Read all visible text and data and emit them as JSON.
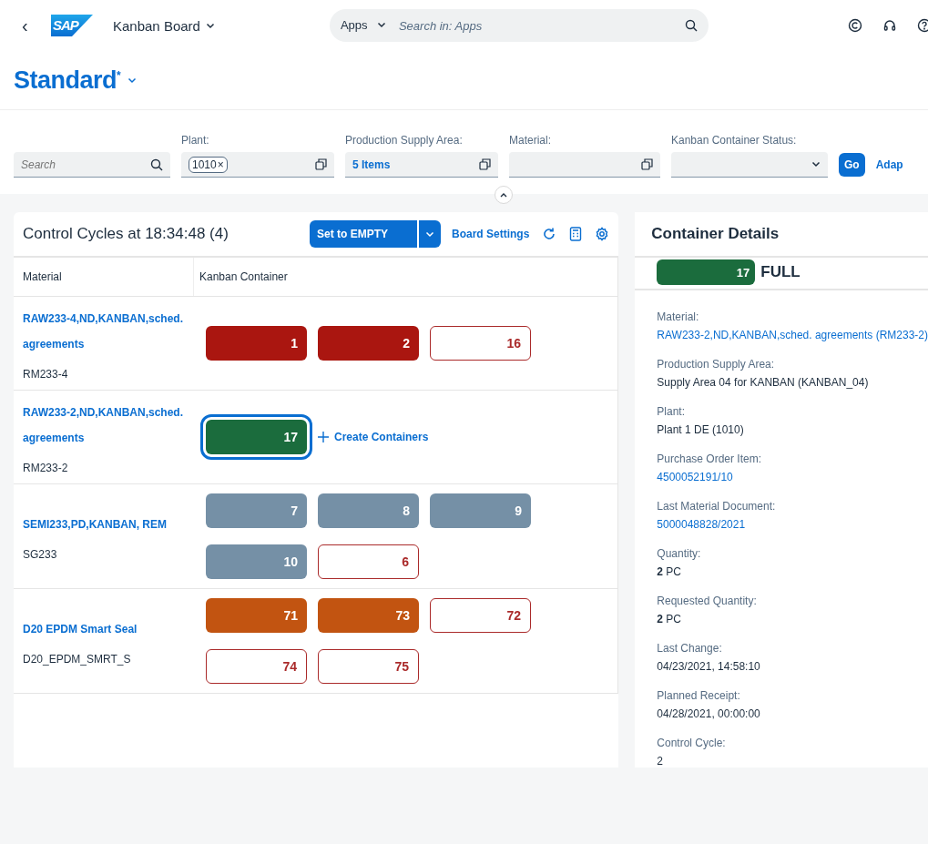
{
  "shell": {
    "back": "‹",
    "logo": "SAP",
    "app_title": "Kanban Board",
    "search_scope": "Apps",
    "search_placeholder": "Search in: Apps"
  },
  "variant": {
    "title": "Standard$^{*}$"
  },
  "filters": {
    "search_placeholder": "Search",
    "fields": [
      {
        "label": "Plant:",
        "kind": "token",
        "value": "1010",
        "remove": "×"
      },
      {
        "label": "Production Supply Area:",
        "kind": "link",
        "value": "5 Items"
      },
      {
        "label": "Material:",
        "kind": "valuehelp"
      },
      {
        "label": "Kanban Container Status:",
        "kind": "select"
      }
    ],
    "go": "Go",
    "adapt": "Adap"
  },
  "board": {
    "title": "Control Cycles at 18:34:48 (4)",
    "action": "Set to EMPTY",
    "settings": "Board Settings",
    "columns": [
      "Material",
      "Kanban Container"
    ],
    "rows": [
      {
        "material": "RAW233-4,ND,KANBAN,sched. agreements",
        "id": "RM233-4",
        "containers": [
          {
            "number": "1",
            "kind": "filled",
            "color": "#aa1610",
            "selected": false
          },
          {
            "number": "2",
            "kind": "filled",
            "color": "#aa1610",
            "selected": false
          },
          {
            "number": "16",
            "kind": "outline",
            "color": "#aa2a2a",
            "selected": false
          }
        ]
      },
      {
        "material": "RAW233-2,ND,KANBAN,sched. agreements",
        "id": "RM233-2",
        "containers": [
          {
            "number": "17",
            "kind": "filled",
            "color": "#1b6c3d",
            "selected": true
          }
        ],
        "create": "Create Containers"
      },
      {
        "material": "SEMI233,PD,KANBAN, REM",
        "id": "SG233",
        "containers": [
          {
            "number": "7",
            "kind": "filled",
            "color": "#7590a6",
            "selected": false
          },
          {
            "number": "8",
            "kind": "filled",
            "color": "#7590a6",
            "selected": false
          },
          {
            "number": "9",
            "kind": "filled",
            "color": "#7590a6",
            "selected": false
          },
          {
            "number": "10",
            "kind": "filled",
            "color": "#7590a6",
            "selected": false
          },
          {
            "number": "6",
            "kind": "outline",
            "color": "#aa2a2a",
            "selected": false
          }
        ]
      },
      {
        "material": "D20 EPDM Smart Seal",
        "id": "D20_EPDM_SMRT_S",
        "containers": [
          {
            "number": "71",
            "kind": "filled",
            "color": "#c25411",
            "selected": false
          },
          {
            "number": "73",
            "kind": "filled",
            "color": "#c25411",
            "selected": false
          },
          {
            "number": "72",
            "kind": "outline",
            "color": "#aa2a2a",
            "selected": false
          },
          {
            "number": "74",
            "kind": "outline",
            "color": "#aa2a2a",
            "selected": false
          },
          {
            "number": "75",
            "kind": "outline",
            "color": "#aa2a2a",
            "selected": false
          }
        ]
      }
    ]
  },
  "details": {
    "title": "Container Details",
    "container": {
      "number": "17",
      "kind": "filled",
      "color": "#1b6c3d",
      "status_text": "FULL"
    },
    "fields": [
      {
        "label": "Material:",
        "value": "RAW233-2,ND,KANBAN,sched. agreements (RM233-2)",
        "kind": "link"
      },
      {
        "label": "Production Supply Area:",
        "value": "Supply Area 04 for KANBAN (KANBAN_04)",
        "kind": "text"
      },
      {
        "label": "Plant:",
        "value": "Plant 1 DE (1010)",
        "kind": "text"
      },
      {
        "label": "Purchase Order Item:",
        "value": "4500052191/10",
        "kind": "link"
      },
      {
        "label": "Last Material Document:",
        "value": "5000048828/2021",
        "kind": "link"
      },
      {
        "label": "Quantity:",
        "value": "**2** PC",
        "kind": "text"
      },
      {
        "label": "Requested Quantity:",
        "value": "**2** PC",
        "kind": "text"
      },
      {
        "label": "Last Change:",
        "value": "04/23/2021, 14:58:10",
        "kind": "text"
      },
      {
        "label": "Planned Receipt:",
        "value": "04/28/2021, 00:00:00",
        "kind": "text"
      },
      {
        "label": "Control Cycle:",
        "value": "2",
        "kind": "text"
      }
    ]
  }
}
